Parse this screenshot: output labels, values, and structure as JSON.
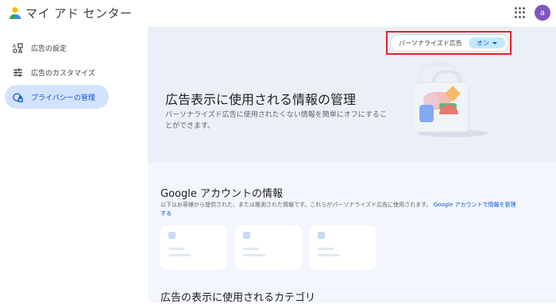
{
  "app": {
    "title": "マイ アド センター",
    "avatar_letter": "a"
  },
  "sidebar": {
    "items": [
      {
        "label": "広告の設定",
        "icon": "ad-settings-icon"
      },
      {
        "label": "広告のカスタマイズ",
        "icon": "tune-icon"
      },
      {
        "label": "プライバシーの管理",
        "icon": "privacy-icon"
      }
    ],
    "active_index": 2
  },
  "personalized_ads": {
    "label": "パーソナライズド広告",
    "state": "オン"
  },
  "hero": {
    "title": "広告表示に使用される情報の管理",
    "description": "パーソナライズド広告に使用されたくない情報を簡単にオフにすることができます。"
  },
  "account_section": {
    "title": "Google アカウントの情報",
    "description": "以下はお客様から提供された、または推測された情報です。これらがパーソナライズド広告に使用されます。",
    "link": "Google アカウントで情報を管理する"
  },
  "categories_section": {
    "title": "広告の表示に使用されるカテゴリ"
  },
  "colors": {
    "accent": "#0b57d0",
    "active_nav_bg": "#d3e3fd",
    "highlight_border": "#e8202a",
    "page_bg": "#f3f6fc"
  }
}
